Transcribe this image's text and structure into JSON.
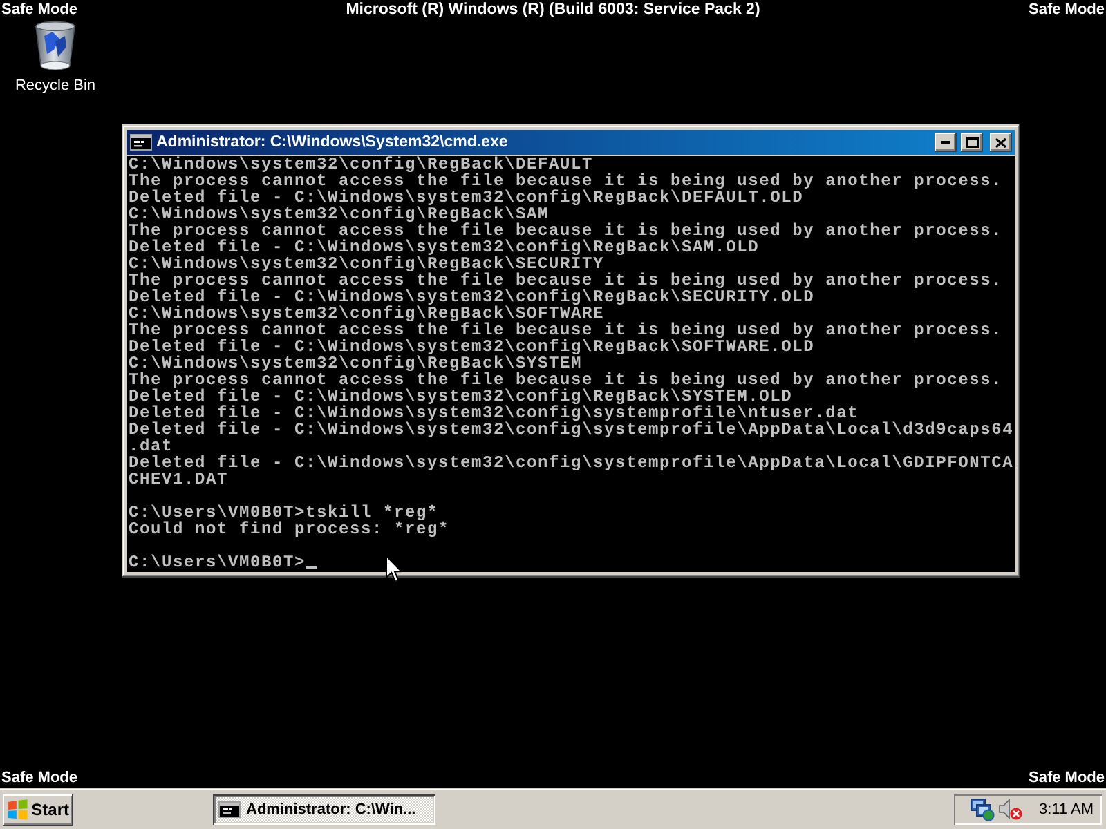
{
  "top_bar": {
    "left": "Safe Mode",
    "center": "Microsoft (R) Windows (R) (Build 6003: Service Pack 2)",
    "right": "Safe Mode"
  },
  "desktop_icons": [
    {
      "label": "Recycle Bin"
    }
  ],
  "console_window": {
    "title": "Administrator: C:\\Windows\\System32\\cmd.exe",
    "blocks": [
      [
        "C:\\Windows\\system32\\config\\RegBack\\DEFAULT",
        "The process cannot access the file because it is being used by another process.",
        "Deleted file - C:\\Windows\\system32\\config\\RegBack\\DEFAULT.OLD",
        "C:\\Windows\\system32\\config\\RegBack\\SAM",
        "The process cannot access the file because it is being used by another process.",
        "Deleted file - C:\\Windows\\system32\\config\\RegBack\\SAM.OLD",
        "C:\\Windows\\system32\\config\\RegBack\\SECURITY",
        "The process cannot access the file because it is being used by another process.",
        "Deleted file - C:\\Windows\\system32\\config\\RegBack\\SECURITY.OLD",
        "C:\\Windows\\system32\\config\\RegBack\\SOFTWARE",
        "The process cannot access the file because it is being used by another process.",
        "Deleted file - C:\\Windows\\system32\\config\\RegBack\\SOFTWARE.OLD",
        "C:\\Windows\\system32\\config\\RegBack\\SYSTEM",
        "The process cannot access the file because it is being used by another process.",
        "Deleted file - C:\\Windows\\system32\\config\\RegBack\\SYSTEM.OLD",
        "Deleted file - C:\\Windows\\system32\\config\\systemprofile\\ntuser.dat",
        "Deleted file - C:\\Windows\\system32\\config\\systemprofile\\AppData\\Local\\d3d9caps64",
        ".dat",
        "Deleted file - C:\\Windows\\system32\\config\\systemprofile\\AppData\\Local\\GDIPFONTCA",
        "CHEV1.DAT"
      ],
      [
        "C:\\Users\\VM0B0T>tskill *reg*",
        "Could not find process: *reg*"
      ],
      [
        "C:\\Users\\VM0B0T>"
      ]
    ],
    "cursor_visible": true
  },
  "bottom_labels": {
    "left": "Safe Mode",
    "right": "Safe Mode"
  },
  "taskbar": {
    "start_label": "Start",
    "buttons": [
      {
        "label": "Administrator: C:\\Win...",
        "selected": true
      }
    ],
    "tray": {
      "sound_muted": true,
      "clock": "3:11 AM"
    }
  }
}
